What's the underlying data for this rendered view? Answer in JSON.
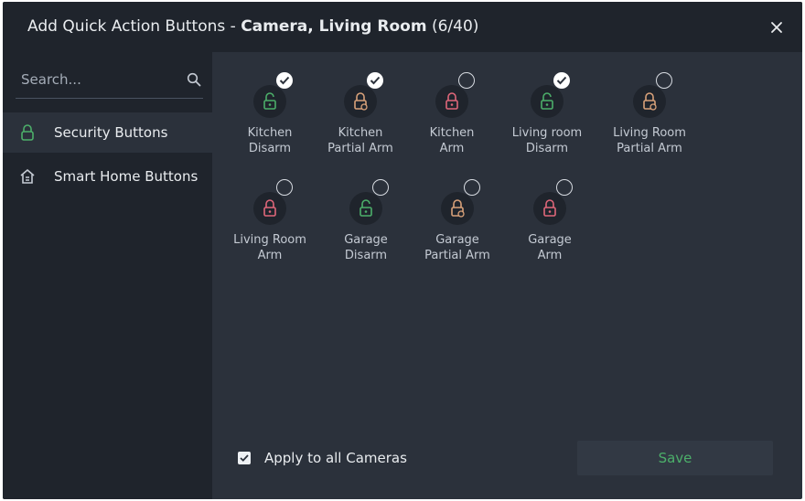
{
  "dialog": {
    "title_prefix": "Add Quick Action Buttons - ",
    "title_bold": "Camera, Living Room",
    "title_count": " (6/40)"
  },
  "search": {
    "placeholder": "Search..."
  },
  "sidebar": {
    "items": [
      {
        "label": "Security Buttons",
        "icon": "lock-icon",
        "active": true
      },
      {
        "label": "Smart Home Buttons",
        "icon": "home-icon",
        "active": false
      }
    ]
  },
  "buttons": [
    {
      "line1": "Kitchen",
      "line2": "Disarm",
      "type": "disarm",
      "checked": true
    },
    {
      "line1": "Kitchen",
      "line2": "Partial Arm",
      "type": "partial",
      "checked": true
    },
    {
      "line1": "Kitchen",
      "line2": "Arm",
      "type": "arm",
      "checked": false
    },
    {
      "line1": "Living room",
      "line2": "Disarm",
      "type": "disarm",
      "checked": true
    },
    {
      "line1": "Living Room",
      "line2": "Partial Arm",
      "type": "partial",
      "checked": false
    },
    {
      "line1": "Living Room",
      "line2": "Arm",
      "type": "arm",
      "checked": false
    },
    {
      "line1": "Garage",
      "line2": "Disarm",
      "type": "disarm",
      "checked": false
    },
    {
      "line1": "Garage",
      "line2": "Partial Arm",
      "type": "partial",
      "checked": false
    },
    {
      "line1": "Garage",
      "line2": "Arm",
      "type": "arm",
      "checked": false
    }
  ],
  "footer": {
    "apply_label": "Apply to all Cameras",
    "apply_checked": true,
    "save_label": "Save"
  },
  "colors": {
    "disarm": "#4caf6a",
    "partial": "#d9a27a",
    "arm": "#e0677a",
    "save_text": "#4caf6a"
  }
}
